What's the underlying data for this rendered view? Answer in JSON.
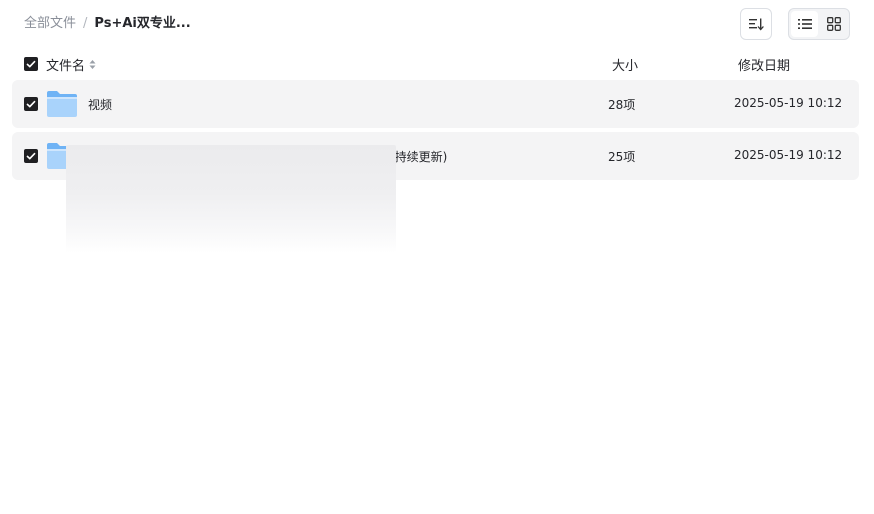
{
  "breadcrumb": {
    "root": "全部文件",
    "separator": "/",
    "current": "Ps+Ai双专业..."
  },
  "toolbar": {
    "sort_icon": "sort-icon",
    "list_view_icon": "list-view-icon",
    "grid_view_icon": "grid-view-icon",
    "active_view": "list"
  },
  "columns": {
    "name": "文件名",
    "size": "大小",
    "date": "修改日期"
  },
  "files": [
    {
      "name": "视频",
      "size": "28项",
      "date": "2025-05-19 10:12",
      "type": "folder",
      "checked": true
    },
    {
      "name": "(持续更新)",
      "size": "25项",
      "date": "2025-05-19 10:12",
      "type": "folder",
      "checked": true
    }
  ],
  "colors": {
    "row_bg": "#f4f4f5",
    "checkbox": "#1f1f22",
    "folder_light": "#a9d3fb",
    "folder_dark": "#6fb3f5",
    "muted_text": "#8a8f99"
  }
}
